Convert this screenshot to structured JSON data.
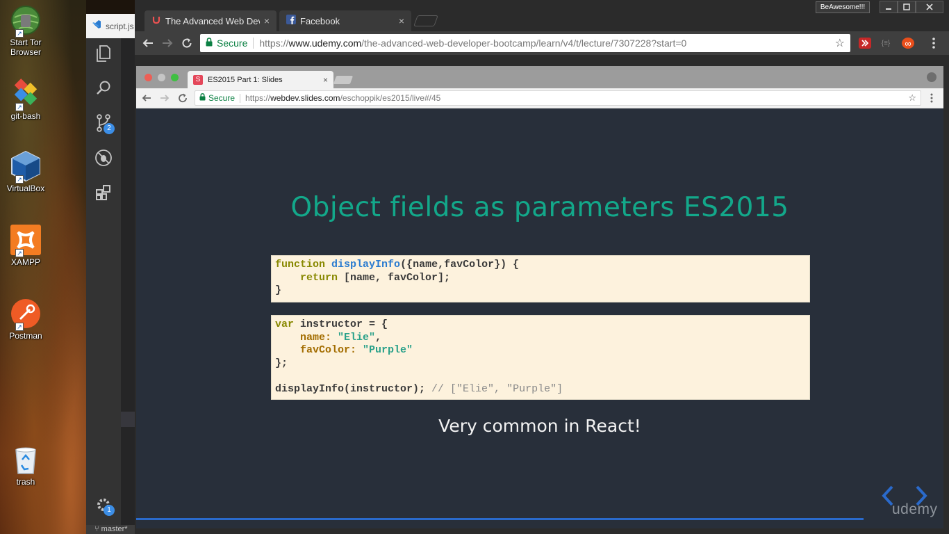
{
  "desktop": {
    "icons": [
      {
        "label": "Start Tor\nBrowser",
        "icon": "tor-browser-icon"
      },
      {
        "label": "git-bash",
        "icon": "git-icon"
      },
      {
        "label": "VirtualBox",
        "icon": "virtualbox-icon"
      },
      {
        "label": "XAMPP",
        "icon": "xampp-icon"
      },
      {
        "label": "Postman",
        "icon": "postman-icon"
      },
      {
        "label": "trash",
        "icon": "recycle-bin-icon"
      }
    ]
  },
  "vscode": {
    "tab_title": "script.js",
    "scm_badge": "2",
    "settings_badge": "1",
    "status_branch": "master*"
  },
  "browser": {
    "tabs": [
      {
        "title": "The Advanced Web Developer",
        "icon": "udemy-icon",
        "close": "×"
      },
      {
        "title": "Facebook",
        "icon": "facebook-icon",
        "close": "×"
      }
    ],
    "user_button": "BeAwesome!!!",
    "window_controls": [
      "minimize",
      "maximize",
      "close"
    ],
    "secure_label": "Secure",
    "url_prefix": "https://",
    "url_host": "www.udemy.com",
    "url_path": "/the-advanced-web-developer-bootcamp/learn/v4/t/lecture/7307228?start=0",
    "extensions": [
      "ext-red-icon",
      "ext-braces-icon",
      "ext-infinity-icon"
    ],
    "extension_text": [
      "",
      "{≡}",
      "∞"
    ]
  },
  "inner_browser": {
    "tab_title": "ES2015 Part 1: Slides",
    "tab_favicon": "S",
    "close": "×",
    "secure_label": "Secure",
    "url_prefix": "https://",
    "url_host": "webdev.slides.com",
    "url_path": "/eschoppik/es2015/live#/45"
  },
  "slide": {
    "title": "Object fields as parameters ES2015",
    "code1": {
      "l1_kw": "function",
      "l1_fn": "displayInfo",
      "l1_rest": "({name,favColor}) {",
      "l2_indent": "    ",
      "l2_kw": "return",
      "l2_rest": " [name, favColor];",
      "l3": "}"
    },
    "code2": {
      "l1_kw": "var",
      "l1_rest": " instructor = {",
      "l2_indent": "    ",
      "l2_prop": "name:",
      "l2_sp": " ",
      "l2_val": "\"Elie\"",
      "l2_end": ",",
      "l3_indent": "    ",
      "l3_prop": "favColor:",
      "l3_sp": " ",
      "l3_val": "\"Purple\"",
      "l4": "};",
      "l6_code": "displayInfo(instructor); ",
      "l6_comment": "// [\"Elie\", \"Purple\"]"
    },
    "subtitle": "Very common in React!",
    "brand": "udemy"
  }
}
